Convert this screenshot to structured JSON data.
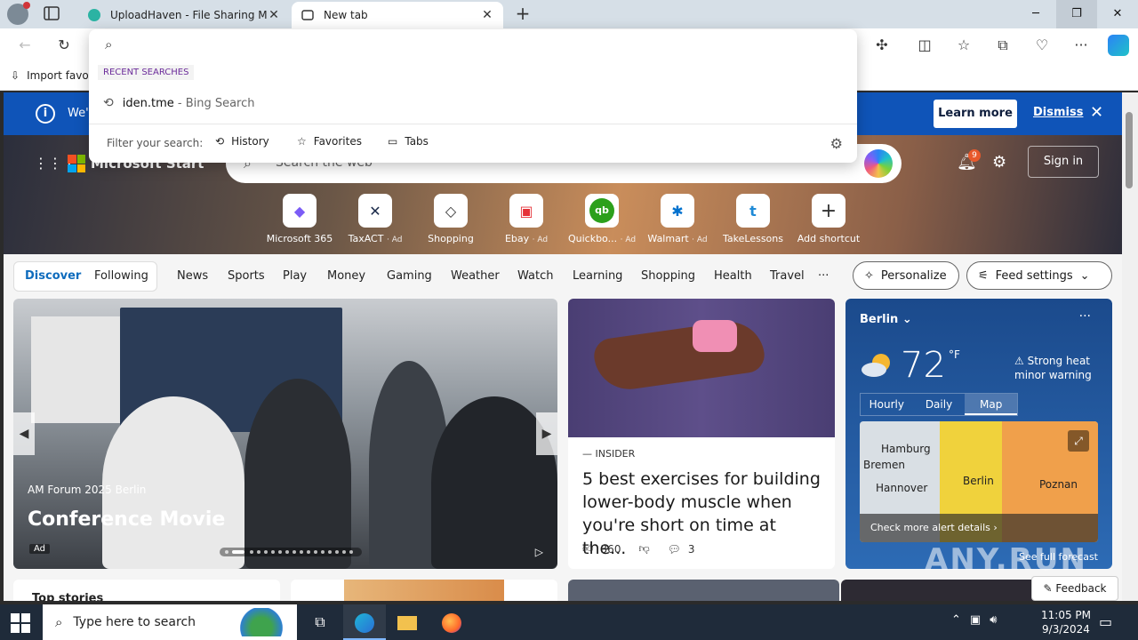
{
  "tabs": [
    {
      "title": "UploadHaven - File Sharing Made Simple"
    },
    {
      "title": "New tab"
    }
  ],
  "favorites_bar": {
    "import_label": "Import favorites"
  },
  "omnibox": {
    "value": "",
    "recent_header": "RECENT SEARCHES",
    "recent": [
      {
        "query": "iden.tme",
        "suffix": " - Bing Search"
      }
    ],
    "filter_label": "Filter your search:",
    "filters": [
      "History",
      "Favorites",
      "Tabs"
    ]
  },
  "banner": {
    "text": "We'",
    "learn_more": "Learn more",
    "dismiss": "Dismiss"
  },
  "header": {
    "brand": "Microsoft Start",
    "search_placeholder": "Search the web",
    "notification_count": "9",
    "sign_in": "Sign in"
  },
  "shortcuts": [
    {
      "label": "Microsoft 365",
      "ad": "",
      "glyph": "◆",
      "color": "#7b5cf6"
    },
    {
      "label": "TaxACT",
      "ad": "· Ad",
      "glyph": "✕",
      "color": "#1b2a4a"
    },
    {
      "label": "Shopping",
      "ad": "",
      "glyph": "◇",
      "color": "#333333"
    },
    {
      "label": "Ebay",
      "ad": "· Ad",
      "glyph": "▣",
      "color": "#e53238"
    },
    {
      "label": "Quickbo...",
      "ad": "· Ad",
      "glyph": "qb",
      "color": "#2ca01c"
    },
    {
      "label": "Walmart",
      "ad": "· Ad",
      "glyph": "✱",
      "color": "#0071ce"
    },
    {
      "label": "TakeLessons",
      "ad": "",
      "glyph": "t",
      "color": "#1f8ad6"
    },
    {
      "label": "Add shortcut",
      "ad": "",
      "glyph": "+",
      "color": "#333333"
    }
  ],
  "feed_nav": {
    "discover": "Discover",
    "following": "Following",
    "links": [
      "News",
      "Sports",
      "Play",
      "Money",
      "Gaming",
      "Weather",
      "Watch",
      "Learning",
      "Shopping",
      "Health",
      "Travel"
    ],
    "more": "···",
    "personalize": "Personalize",
    "feed_settings": "Feed settings"
  },
  "hero_card": {
    "subtitle": "AM Forum 2025 Berlin",
    "title": "Conference Movie",
    "ad": "Ad"
  },
  "news_card": {
    "source": "INSIDER",
    "headline": "5 best exercises for building lower-body muscle when you're short on time at the...",
    "likes": "360",
    "comments": "3"
  },
  "weather": {
    "city": "Berlin",
    "temp": "72",
    "unit": "°F",
    "warning": "Strong heat minor warning",
    "tabs": [
      "Hourly",
      "Daily",
      "Map"
    ],
    "map_labels": [
      "Hamburg",
      "Bremen",
      "Hannover",
      "Berlin",
      "Poznan"
    ],
    "alert": "Check more alert details",
    "forecast": "See full forecast"
  },
  "top_stories": "Top stories",
  "feedback": "Feedback",
  "taskbar": {
    "search_placeholder": "Type here to search",
    "time": "11:05 PM",
    "date": "9/3/2024"
  },
  "watermark": "ANY.RUN"
}
